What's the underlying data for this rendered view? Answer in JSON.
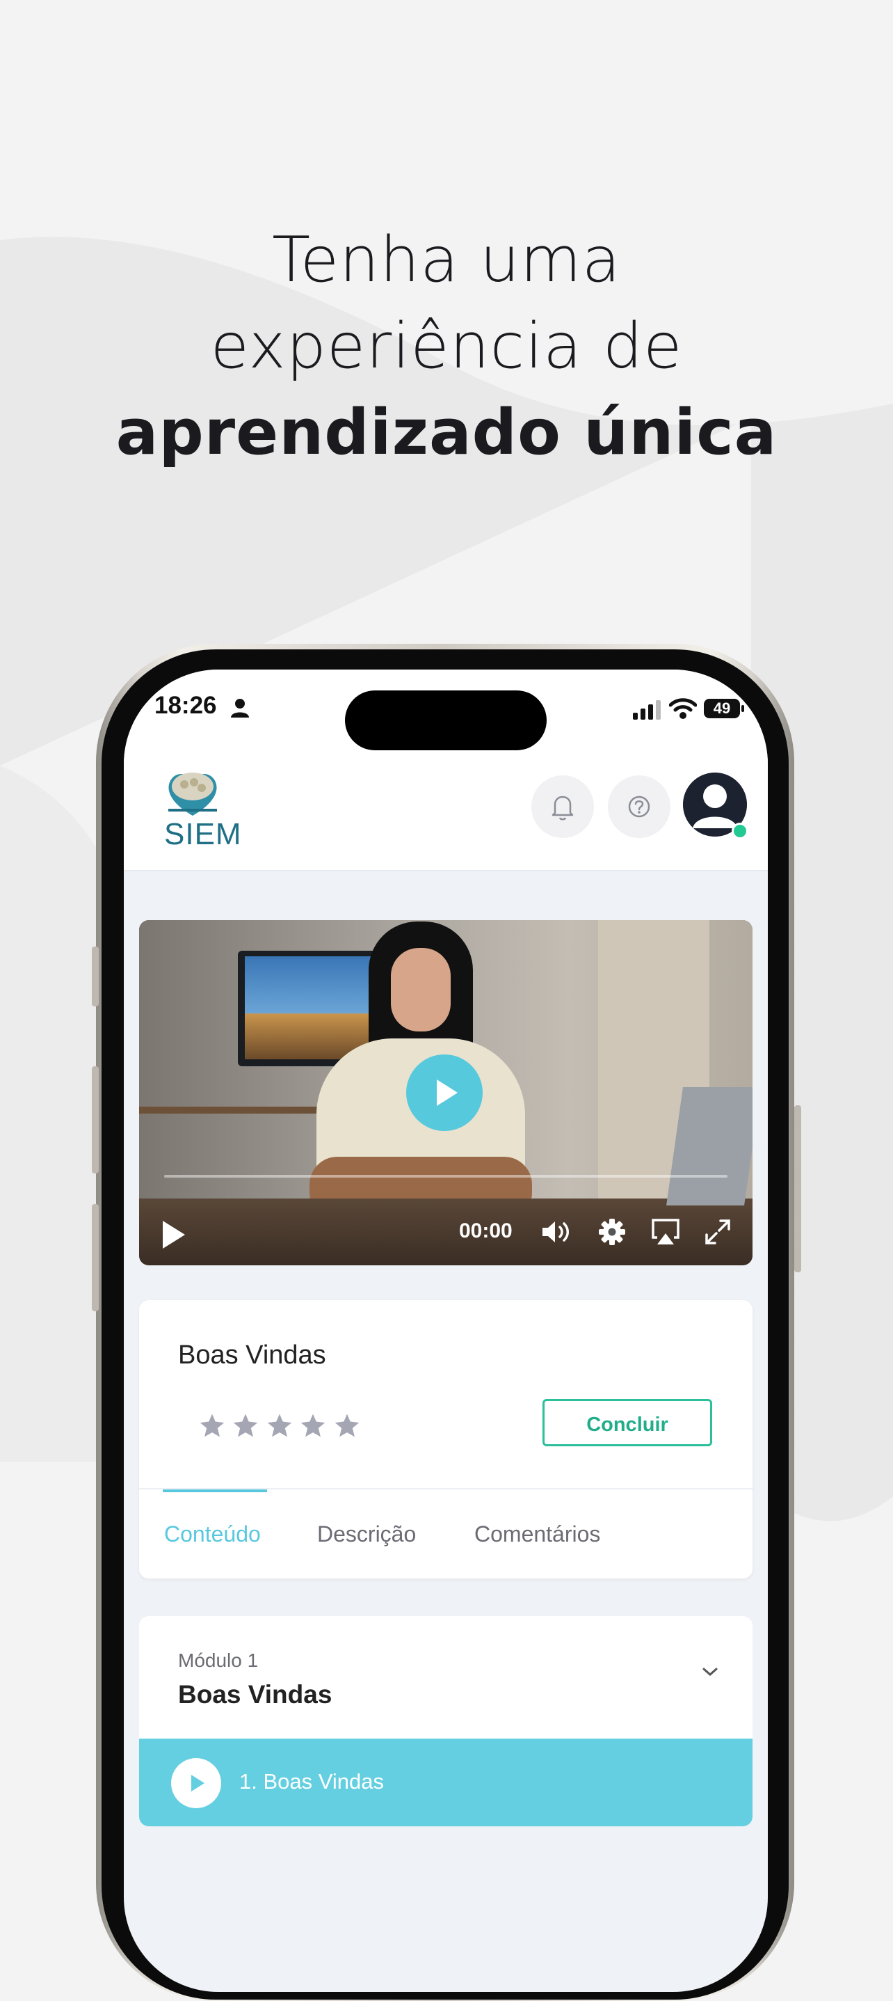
{
  "headline": {
    "line1": "Tenha uma",
    "line2": "experiência de",
    "line3": "aprendizado única"
  },
  "status_bar": {
    "time": "18:26",
    "battery": "49"
  },
  "header": {
    "logo_text": "SIEM"
  },
  "video": {
    "current_time": "00:00"
  },
  "lesson": {
    "title": "Boas Vindas",
    "rating_stars": 5,
    "complete_label": "Concluir",
    "tabs": [
      {
        "label": "Conteúdo",
        "active": true
      },
      {
        "label": "Descrição",
        "active": false
      },
      {
        "label": "Comentários",
        "active": false
      }
    ]
  },
  "module": {
    "subtitle": "Módulo 1",
    "title": "Boas Vindas",
    "items": [
      {
        "label": "1. Boas Vindas"
      }
    ]
  },
  "colors": {
    "accent": "#58c8de",
    "complete_green": "#2bbf9a",
    "online": "#22c993"
  }
}
